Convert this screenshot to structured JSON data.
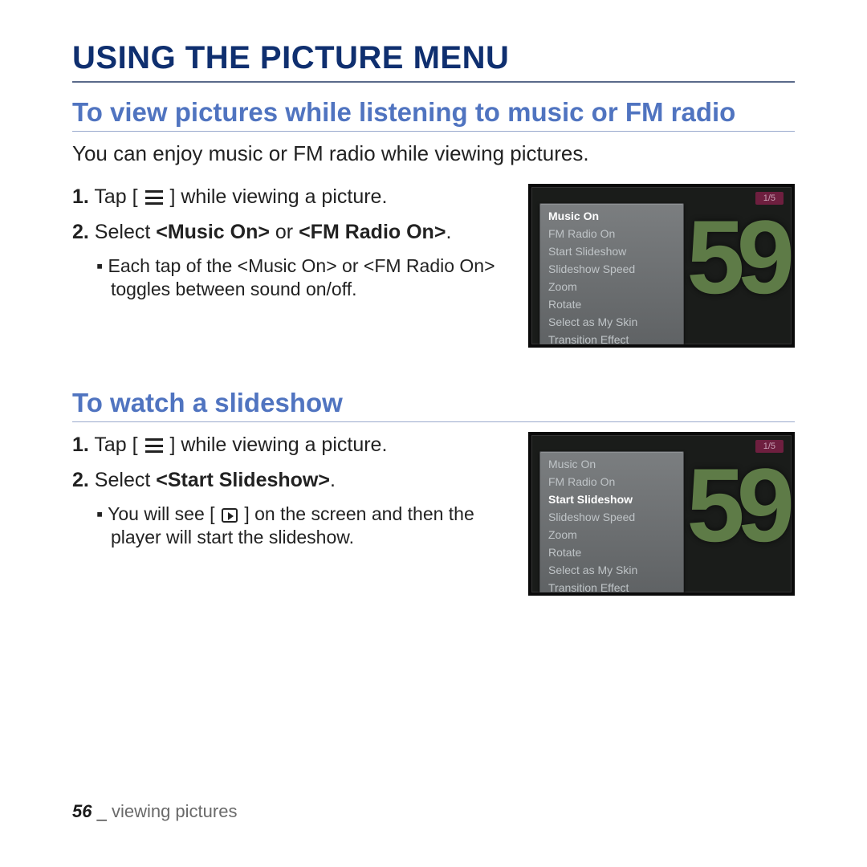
{
  "page": {
    "title": "USING THE PICTURE MENU",
    "footer_page": "56",
    "footer_sep": " _ ",
    "footer_chapter": "viewing pictures"
  },
  "section1": {
    "heading": "To view pictures while listening to music or FM radio",
    "intro": "You can enjoy music or FM radio while viewing pictures.",
    "step1_a": "1.",
    "step1_b": " Tap [ ",
    "step1_c": " ] while viewing a picture.",
    "step2_a": "2.",
    "step2_b": " Select ",
    "step2_c": "<Music On>",
    "step2_d": " or ",
    "step2_e": "<FM Radio On>",
    "step2_f": ".",
    "bullet": "Each tap of the <Music On> or <FM Radio On> toggles between sound on/off.",
    "device_badge": "1/5",
    "device_number": "59",
    "menu_items": [
      "Music On",
      "FM Radio On",
      "Start Slideshow",
      "Slideshow Speed",
      "Zoom",
      "Rotate",
      "Select as My Skin",
      "Transition Effect"
    ],
    "menu_selected_index": 0
  },
  "section2": {
    "heading": "To watch a slideshow",
    "step1_a": "1.",
    "step1_b": " Tap [ ",
    "step1_c": " ] while viewing a picture.",
    "step2_a": "2.",
    "step2_b": " Select ",
    "step2_c": "<Start Slideshow>",
    "step2_d": ".",
    "bullet_a": "You will see [ ",
    "bullet_b": " ] on the screen and then the player will start the slideshow.",
    "device_badge": "1/5",
    "device_number": "59",
    "menu_items": [
      "Music On",
      "FM Radio On",
      "Start Slideshow",
      "Slideshow Speed",
      "Zoom",
      "Rotate",
      "Select as My Skin",
      "Transition Effect"
    ],
    "menu_selected_index": 2
  }
}
